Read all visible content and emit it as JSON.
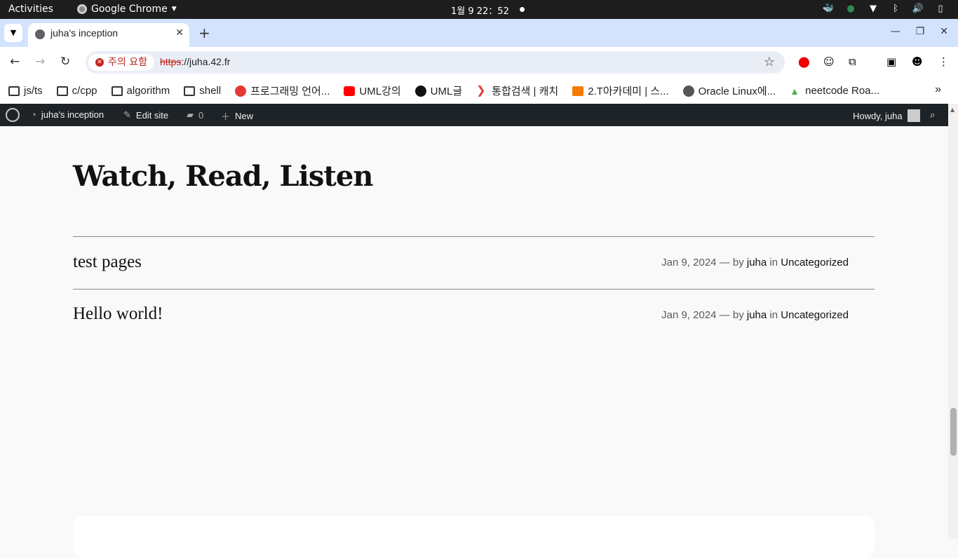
{
  "os_bar": {
    "activities": "Activities",
    "app_name": "Google Chrome",
    "clock": "1월 9  22：52"
  },
  "browser": {
    "tab_title": "juha's inception",
    "security_chip": "주의 요함",
    "url_scheme": "https",
    "url_rest": "://juha.42.fr",
    "bookmarks": [
      {
        "label": "js/ts",
        "icon": "folder-icon"
      },
      {
        "label": "c/cpp",
        "icon": "folder-icon"
      },
      {
        "label": "algorithm",
        "icon": "folder-icon"
      },
      {
        "label": "shell",
        "icon": "folder-icon"
      },
      {
        "label": "프로그래밍 언어...",
        "icon": "site-icon"
      },
      {
        "label": "UML강의",
        "icon": "youtube-icon"
      },
      {
        "label": "UML글",
        "icon": "site-icon"
      },
      {
        "label": "통합검색 | 캐치",
        "icon": "site-icon"
      },
      {
        "label": "2.T아카데미 | 스...",
        "icon": "site-icon"
      },
      {
        "label": "Oracle Linux에...",
        "icon": "globe-icon"
      },
      {
        "label": "neetcode Roa...",
        "icon": "site-icon"
      }
    ]
  },
  "wp_admin_bar": {
    "site_name": "juha's inception",
    "edit_site": "Edit site",
    "comments_count": "0",
    "new": "New",
    "howdy": "Howdy, juha"
  },
  "page": {
    "title": "Watch, Read, Listen",
    "posts": [
      {
        "title": "test pages",
        "date": "Jan 9, 2024",
        "sep": "—",
        "by": "by",
        "author": "juha",
        "in": "in",
        "category": "Uncategorized"
      },
      {
        "title": "Hello world!",
        "date": "Jan 9, 2024",
        "sep": "—",
        "by": "by",
        "author": "juha",
        "in": "in",
        "category": "Uncategorized"
      }
    ]
  }
}
